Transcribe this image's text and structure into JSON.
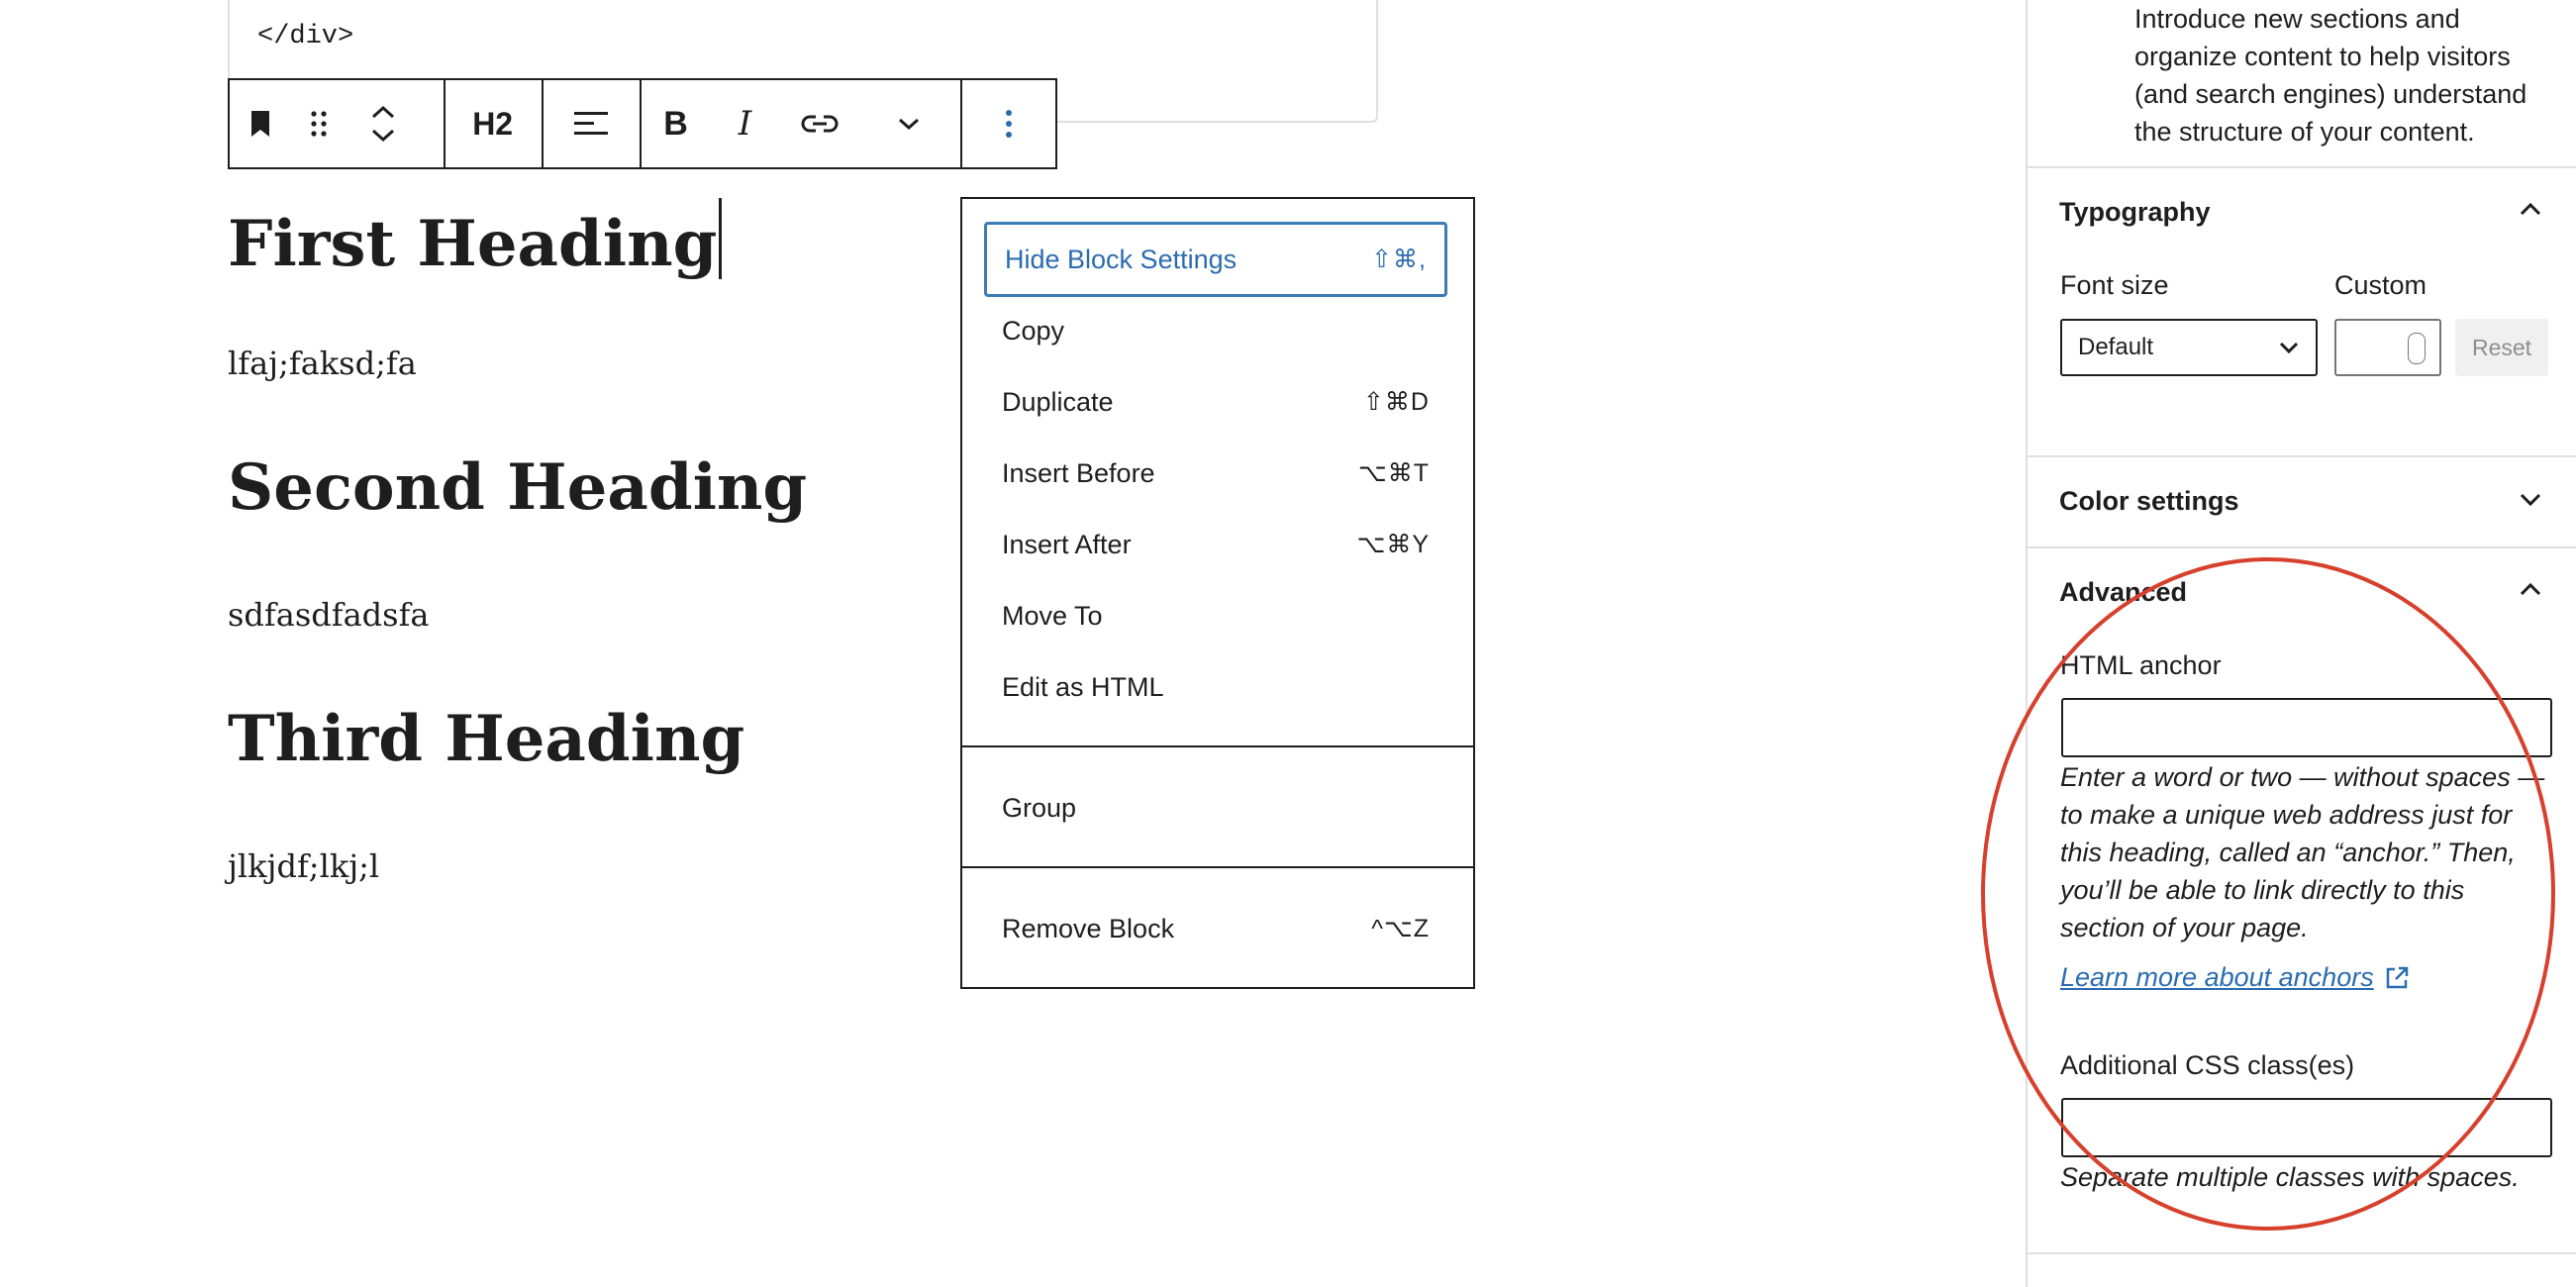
{
  "editor": {
    "code_snippet": "</div>",
    "toolbar": {
      "heading_level": "H2"
    },
    "headings": [
      "First Heading",
      "Second Heading",
      "Third Heading"
    ],
    "paragraphs": [
      "lfaj;faksd;fa",
      "sdfasdfadsfa",
      "jlkjdf;lkj;l"
    ]
  },
  "block_menu": {
    "items": [
      {
        "label": "Hide Block Settings",
        "shortcut": "⇧⌘,"
      },
      {
        "label": "Copy",
        "shortcut": ""
      },
      {
        "label": "Duplicate",
        "shortcut": "⇧⌘D"
      },
      {
        "label": "Insert Before",
        "shortcut": "⌥⌘T"
      },
      {
        "label": "Insert After",
        "shortcut": "⌥⌘Y"
      },
      {
        "label": "Move To",
        "shortcut": ""
      },
      {
        "label": "Edit as HTML",
        "shortcut": ""
      },
      {
        "label": "Group",
        "shortcut": ""
      },
      {
        "label": "Remove Block",
        "shortcut": "^⌥Z"
      }
    ]
  },
  "sidebar": {
    "block_description": "Introduce new sections and organize content to help visitors (and search engines) understand the structure of your content.",
    "typography": {
      "title": "Typography",
      "font_size_label": "Font size",
      "custom_label": "Custom",
      "font_size_value": "Default",
      "reset_label": "Reset"
    },
    "color_settings": {
      "title": "Color settings"
    },
    "advanced": {
      "title": "Advanced",
      "anchor_label": "HTML anchor",
      "anchor_help": "Enter a word or two — without spaces — to make a unique web address just for this heading, called an “anchor.” Then, you’ll be able to link directly to this section of your page.",
      "learn_more": "Learn more about anchors",
      "css_label": "Additional CSS class(es)",
      "css_help": "Separate multiple classes with spaces."
    }
  },
  "colors": {
    "accent": "#2b6cb0",
    "annotation": "#d6402c"
  }
}
